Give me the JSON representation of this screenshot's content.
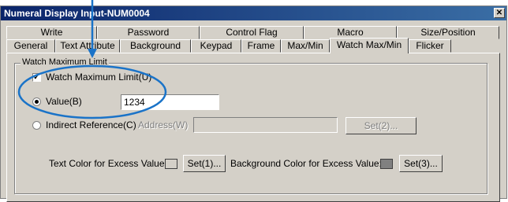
{
  "window": {
    "title": "Numeral Display Input-NUM0004",
    "close_glyph": "✕"
  },
  "tabs_row1": [
    "Write",
    "Password",
    "Control Flag",
    "Macro",
    "Size/Position"
  ],
  "tabs_row2": [
    "General",
    "Text Attribute",
    "Background",
    "Keypad",
    "Frame",
    "Max/Min",
    "Watch Max/Min",
    "Flicker"
  ],
  "active_tab": "Watch Max/Min",
  "group": {
    "label": "Watch Maximum Limit",
    "watch_checkbox": {
      "label": "Watch Maximum Limit(U)",
      "checked": true
    },
    "value_radio": {
      "label": "Value(B)",
      "selected": true,
      "value": "1234"
    },
    "indirect_radio": {
      "label": "Indirect Reference(C)",
      "selected": false
    },
    "address_label": "Address(W)",
    "address_value": "",
    "set2_button": "Set(2)...",
    "text_color_label": "Text Color for Excess Value:",
    "text_color": "#d4d0c8",
    "set1_button": "Set(1)...",
    "bg_color_label": "Background Color for Excess Value:",
    "bg_color": "#808080",
    "set3_button": "Set(3)..."
  },
  "annotation_color": "#1a73c8"
}
